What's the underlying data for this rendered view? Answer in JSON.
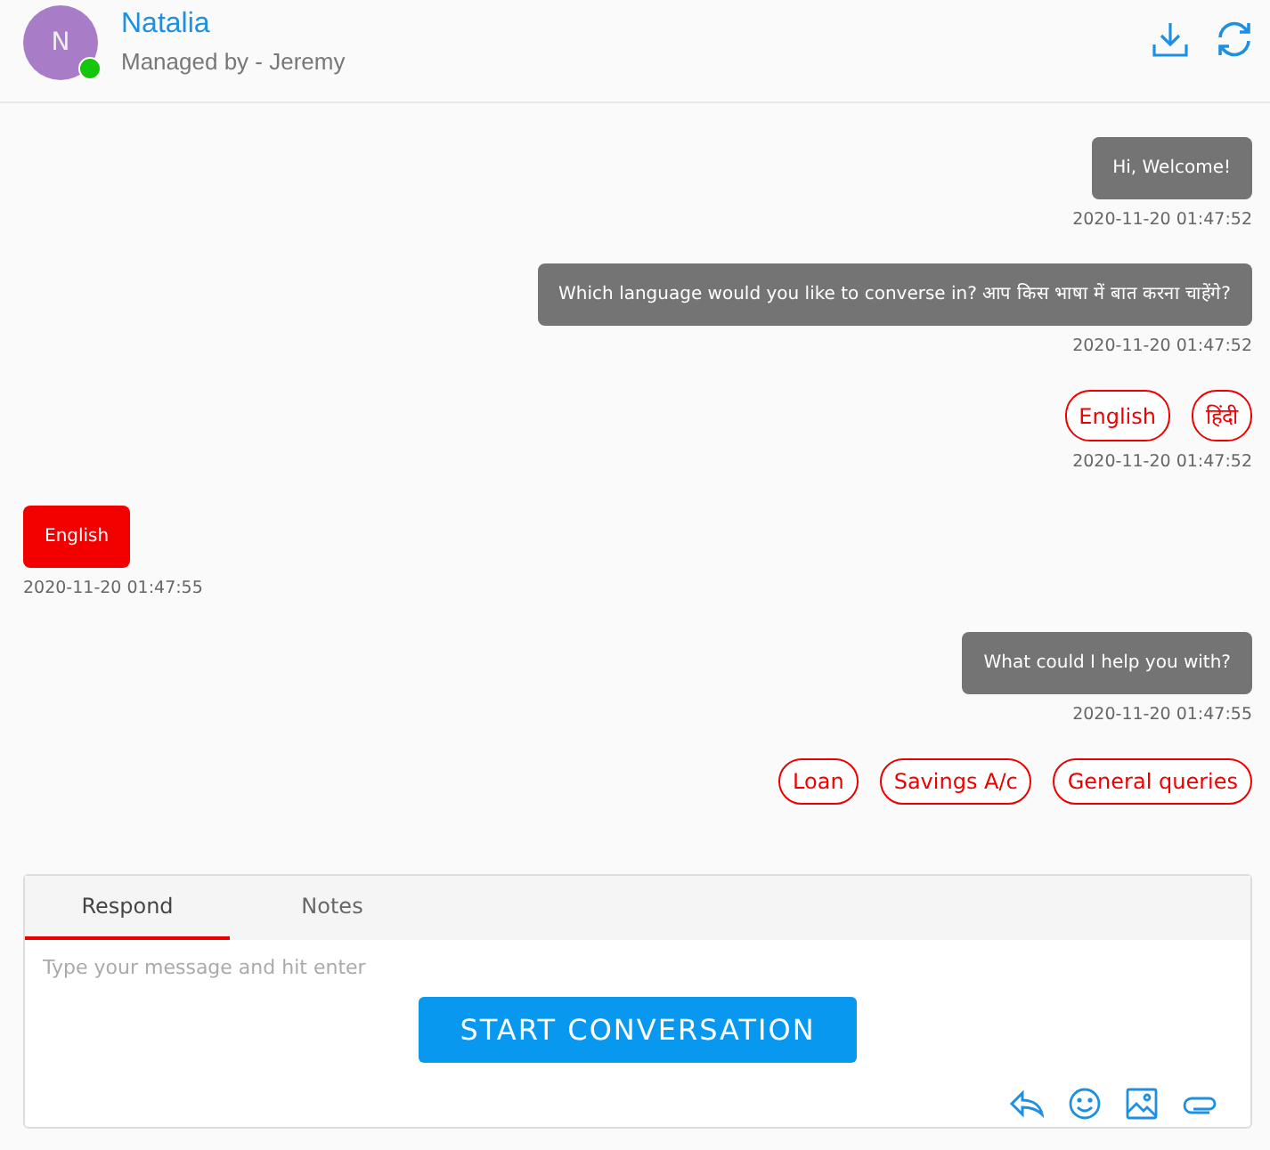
{
  "header": {
    "avatar_initial": "N",
    "online": true,
    "name": "Natalia",
    "subtitle": "Managed by - Jeremy"
  },
  "messages": [
    {
      "kind": "bot_text",
      "text": "Hi, Welcome!",
      "time": "2020-11-20 01:47:52"
    },
    {
      "kind": "bot_text",
      "text": "Which language would you like to converse in? आप किस भाषा में बात करना चाहेंगे?",
      "time": "2020-11-20 01:47:52"
    },
    {
      "kind": "options",
      "options": [
        "English",
        "हिंदी"
      ],
      "time": "2020-11-20 01:47:52"
    },
    {
      "kind": "user_text",
      "text": "English",
      "time": "2020-11-20 01:47:55"
    },
    {
      "kind": "bot_text",
      "text": "What could I help you with?",
      "time": "2020-11-20 01:47:55"
    },
    {
      "kind": "options",
      "options": [
        "Loan",
        "Savings A/c",
        "General queries"
      ]
    }
  ],
  "composer": {
    "tabs": [
      {
        "label": "Respond",
        "selected": true
      },
      {
        "label": "Notes",
        "selected": false
      }
    ],
    "placeholder": "Type your message and hit enter",
    "button": "START CONVERSATION"
  }
}
